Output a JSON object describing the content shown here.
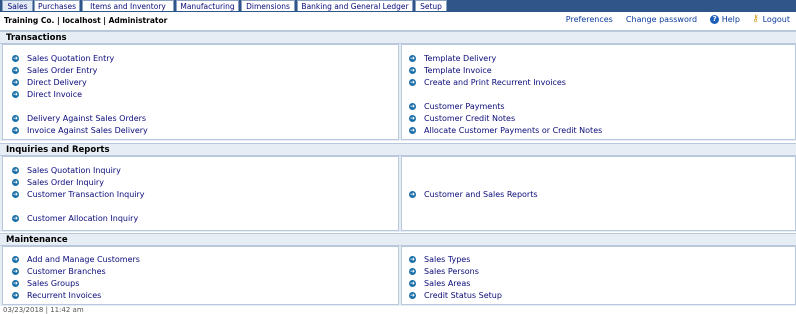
{
  "tabs": [
    "Sales",
    "Purchases",
    "Items and Inventory",
    "Manufacturing",
    "Dimensions",
    "Banking and General Ledger",
    "Setup"
  ],
  "topbar": {
    "company": "Training Co. | localhost | Administrator",
    "preferences": "Preferences",
    "change_password": "Change password",
    "help": "Help",
    "logout": "Logout"
  },
  "sections": {
    "transactions": {
      "title": "Transactions",
      "left": [
        "Sales Quotation Entry",
        "Sales Order Entry",
        "Direct Delivery",
        "Direct Invoice",
        "Delivery Against Sales Orders",
        "Invoice Against Sales Delivery"
      ],
      "right": [
        "Template Delivery",
        "Template Invoice",
        "Create and Print Recurrent Invoices",
        "Customer Payments",
        "Customer Credit Notes",
        "Allocate Customer Payments or Credit Notes"
      ]
    },
    "inquiries": {
      "title": "Inquiries and Reports",
      "left": [
        "Sales Quotation Inquiry",
        "Sales Order Inquiry",
        "Customer Transaction Inquiry",
        "Customer Allocation Inquiry"
      ],
      "right": [
        "Customer and Sales Reports"
      ]
    },
    "maintenance": {
      "title": "Maintenance",
      "left": [
        "Add and Manage Customers",
        "Customer Branches",
        "Sales Groups",
        "Recurrent Invoices"
      ],
      "right": [
        "Sales Types",
        "Sales Persons",
        "Sales Areas",
        "Credit Status Setup"
      ]
    }
  },
  "footer": "03/23/2018 | 11:42 am",
  "colors": {
    "tabbar": "#2f5589",
    "section_bg": "#e6edf4",
    "link": "#0a0a7a",
    "bullet": "#1b6fa8"
  },
  "icons": {
    "bullet": "arrow-circle-icon",
    "help": "help-icon",
    "logout": "key-icon"
  }
}
